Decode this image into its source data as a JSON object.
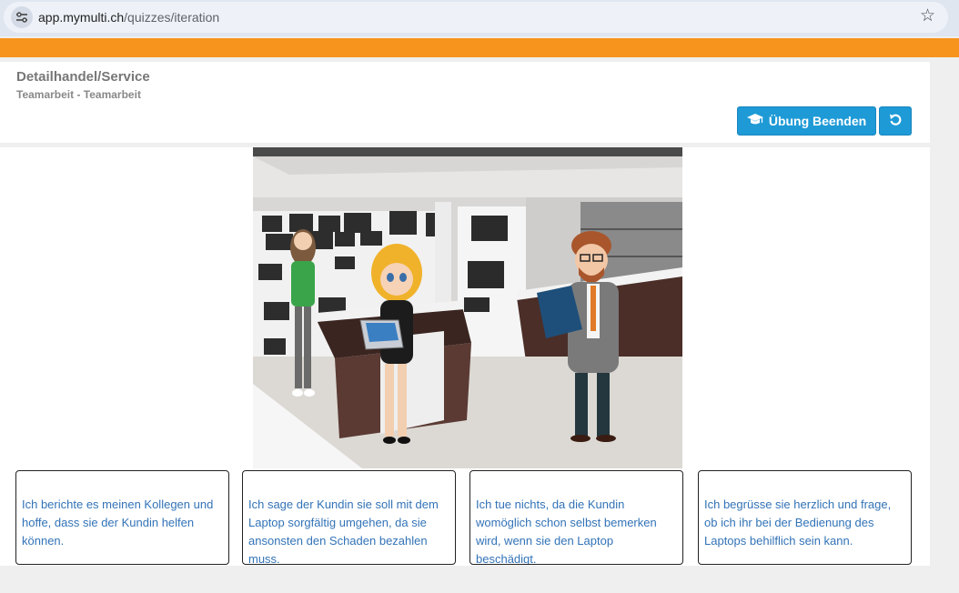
{
  "browser": {
    "url_host": "app.mymulti.ch",
    "url_path": "/quizzes/iteration"
  },
  "header": {
    "title": "Detailhandel/Service",
    "subtitle": "Teamarbeit - Teamarbeit",
    "end_button_label": "Übung Beenden"
  },
  "answers": [
    {
      "text": "Ich berichte es meinen Kollegen und hoffe, dass sie der Kundin helfen können."
    },
    {
      "text": "Ich sage der Kundin sie soll mit dem Laptop sorgfältig umgehen, da sie ansonsten den Schaden bezahlen muss."
    },
    {
      "text": "Ich tue nichts, da die Kundin womöglich schon selbst bemerken wird, wenn sie den Laptop beschädigt."
    },
    {
      "text": "Ich begrüsse sie herzlich und frage, ob ich ihr bei der Bedienung des Laptops behilflich sein kann."
    }
  ],
  "colors": {
    "accent_orange": "#f7941d",
    "button_blue": "#1e9ad6",
    "answer_text": "#3273b7"
  }
}
